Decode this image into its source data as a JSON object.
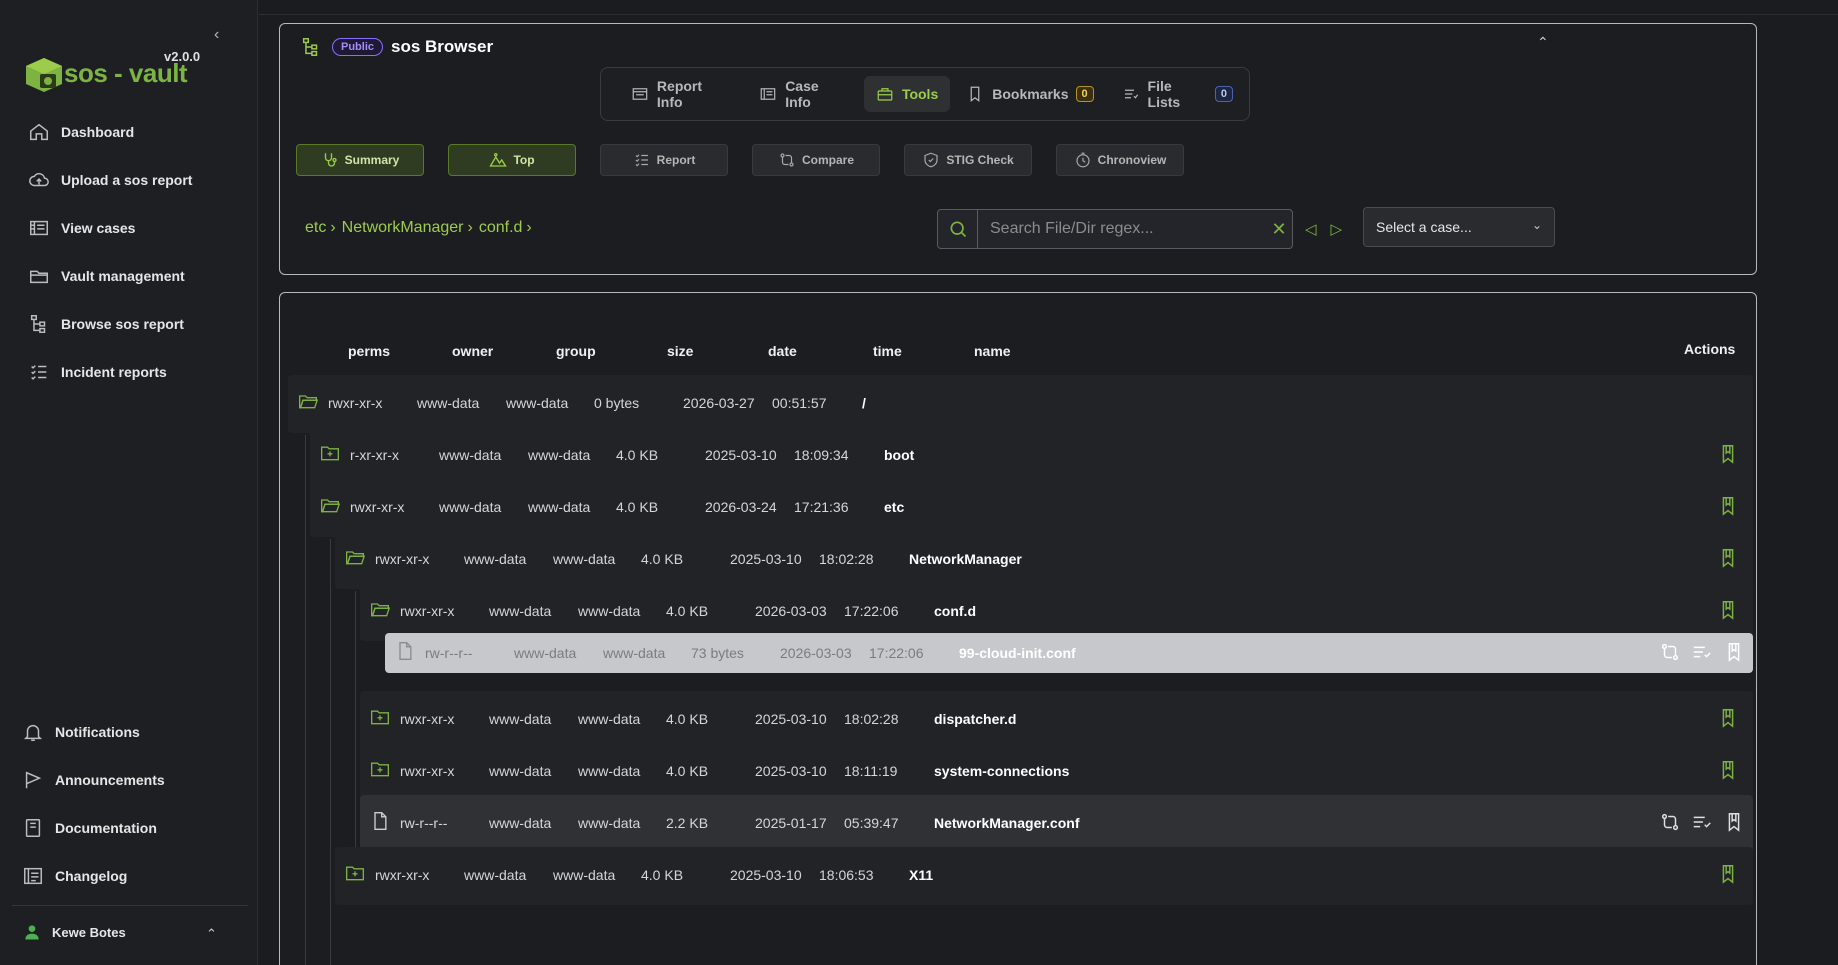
{
  "app": {
    "name": "sos - vault",
    "version": "v2.0.0"
  },
  "sidebar": {
    "items": [
      {
        "label": "Dashboard",
        "icon": "home-icon"
      },
      {
        "label": "Upload a sos report",
        "icon": "cloud-upload-icon"
      },
      {
        "label": "View cases",
        "icon": "cases-icon"
      },
      {
        "label": "Vault management",
        "icon": "folder-icon"
      },
      {
        "label": "Browse sos report",
        "icon": "tree-icon"
      },
      {
        "label": "Incident reports",
        "icon": "checklist-icon"
      }
    ],
    "bottom_items": [
      {
        "label": "Notifications",
        "icon": "bell-icon"
      },
      {
        "label": "Announcements",
        "icon": "flag-icon"
      },
      {
        "label": "Documentation",
        "icon": "book-icon"
      },
      {
        "label": "Changelog",
        "icon": "changelog-icon"
      }
    ],
    "user": "Kewe Botes"
  },
  "browser": {
    "badge": "Public",
    "title": "sos Browser",
    "tabs": [
      {
        "label": "Report Info"
      },
      {
        "label": "Case Info"
      },
      {
        "label": "Tools",
        "active": true
      },
      {
        "label": "Bookmarks",
        "count": "0"
      },
      {
        "label": "File Lists",
        "count": "0"
      }
    ],
    "tools": [
      {
        "label": "Summary",
        "active": true
      },
      {
        "label": "Top",
        "active": true
      },
      {
        "label": "Report"
      },
      {
        "label": "Compare"
      },
      {
        "label": "STIG Check"
      },
      {
        "label": "Chronoview"
      }
    ],
    "breadcrumb": [
      "etc",
      "NetworkManager",
      "conf.d"
    ],
    "search": {
      "placeholder": "Search File/Dir regex...",
      "value": ""
    },
    "case_select": "Select a case..."
  },
  "table": {
    "headers": {
      "perms": "perms",
      "owner": "owner",
      "group": "group",
      "size": "size",
      "date": "date",
      "time": "time",
      "name": "name",
      "actions": "Actions"
    },
    "rows": [
      {
        "perms": "rwxr-xr-x",
        "owner": "www-data",
        "group": "www-data",
        "size": "0 bytes",
        "date": "2026-03-27",
        "time": "00:51:57",
        "name": "/"
      },
      {
        "perms": "r-xr-xr-x",
        "owner": "www-data",
        "group": "www-data",
        "size": "4.0 KB",
        "date": "2025-03-10",
        "time": "18:09:34",
        "name": "boot"
      },
      {
        "perms": "rwxr-xr-x",
        "owner": "www-data",
        "group": "www-data",
        "size": "4.0 KB",
        "date": "2026-03-24",
        "time": "17:21:36",
        "name": "etc"
      },
      {
        "perms": "rwxr-xr-x",
        "owner": "www-data",
        "group": "www-data",
        "size": "4.0 KB",
        "date": "2025-03-10",
        "time": "18:02:28",
        "name": "NetworkManager"
      },
      {
        "perms": "rwxr-xr-x",
        "owner": "www-data",
        "group": "www-data",
        "size": "4.0 KB",
        "date": "2026-03-03",
        "time": "17:22:06",
        "name": "conf.d"
      },
      {
        "perms": "rw-r--r--",
        "owner": "www-data",
        "group": "www-data",
        "size": "73 bytes",
        "date": "2026-03-03",
        "time": "17:22:06",
        "name": "99-cloud-init.conf"
      },
      {
        "perms": "rwxr-xr-x",
        "owner": "www-data",
        "group": "www-data",
        "size": "4.0 KB",
        "date": "2025-03-10",
        "time": "18:02:28",
        "name": "dispatcher.d"
      },
      {
        "perms": "rwxr-xr-x",
        "owner": "www-data",
        "group": "www-data",
        "size": "4.0 KB",
        "date": "2025-03-10",
        "time": "18:11:19",
        "name": "system-connections"
      },
      {
        "perms": "rw-r--r--",
        "owner": "www-data",
        "group": "www-data",
        "size": "2.2 KB",
        "date": "2025-01-17",
        "time": "05:39:47",
        "name": "NetworkManager.conf"
      },
      {
        "perms": "rwxr-xr-x",
        "owner": "www-data",
        "group": "www-data",
        "size": "4.0 KB",
        "date": "2025-03-10",
        "time": "18:06:53",
        "name": "X11"
      }
    ]
  },
  "colors": {
    "accent": "#7cb342",
    "background": "#1b1c20",
    "badge": "#8a6dff"
  }
}
